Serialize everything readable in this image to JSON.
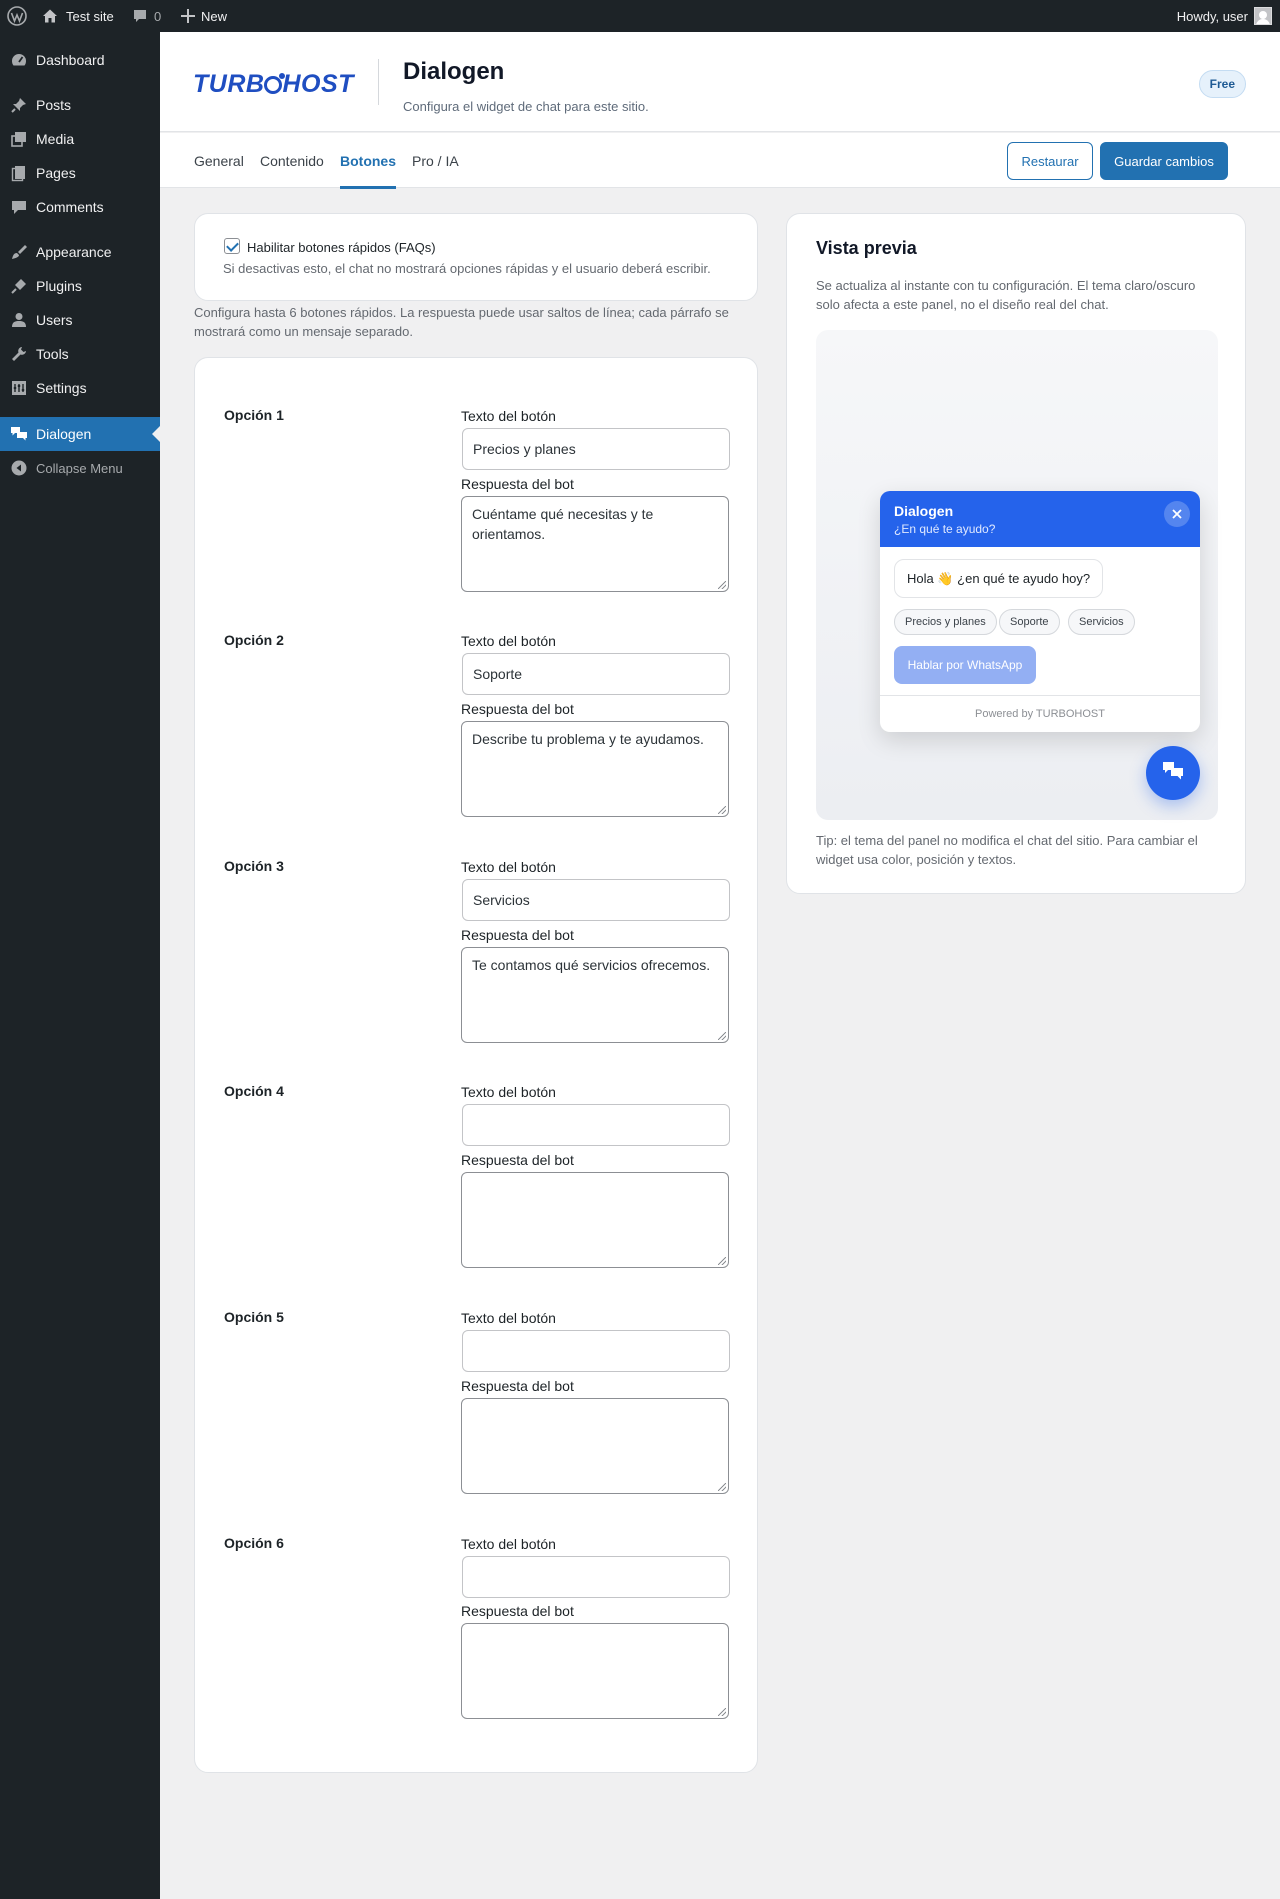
{
  "adminbar": {
    "site_name": "Test site",
    "comments_count": "0",
    "new_label": "New",
    "greeting": "Howdy, user"
  },
  "sidebar": {
    "items": [
      {
        "label": "Dashboard",
        "icon": "dashboard-icon"
      },
      {
        "label": "Posts",
        "icon": "pin-icon"
      },
      {
        "label": "Media",
        "icon": "media-icon"
      },
      {
        "label": "Pages",
        "icon": "pages-icon"
      },
      {
        "label": "Comments",
        "icon": "comment-icon"
      },
      {
        "label": "Appearance",
        "icon": "brush-icon"
      },
      {
        "label": "Plugins",
        "icon": "plug-icon"
      },
      {
        "label": "Users",
        "icon": "user-icon"
      },
      {
        "label": "Tools",
        "icon": "wrench-icon"
      },
      {
        "label": "Settings",
        "icon": "settings-icon"
      },
      {
        "label": "Dialogen",
        "icon": "chat-bubbles-icon",
        "active": true
      }
    ],
    "collapse_label": "Collapse Menu"
  },
  "header": {
    "logo_text_before": "TURB",
    "logo_text_after": "HOST",
    "title": "Dialogen",
    "subtitle": "Configura el widget de chat para este sitio.",
    "plan_badge": "Free"
  },
  "tabs": [
    {
      "label": "General"
    },
    {
      "label": "Contenido"
    },
    {
      "label": "Botones",
      "active": true
    },
    {
      "label": "Pro / IA"
    }
  ],
  "actions": {
    "restore_label": "Restaurar",
    "save_label": "Guardar cambios"
  },
  "faq_toggle": {
    "checked": true,
    "label": "Habilitar botones rápidos (FAQs)",
    "help": "Si desactivas esto, el chat no mostrará opciones rápidas y el usuario deberá escribir."
  },
  "intro_note": "Configura hasta 6 botones rápidos. La respuesta puede usar saltos de línea; cada párrafo se mostrará como un mensaje separado.",
  "options": [
    {
      "title": "Opción 1",
      "button_label": "Texto del botón",
      "button_value": "Precios y planes",
      "response_label": "Respuesta del bot",
      "response_value": "Cuéntame qué necesitas y te orientamos."
    },
    {
      "title": "Opción 2",
      "button_label": "Texto del botón",
      "button_value": "Soporte",
      "response_label": "Respuesta del bot",
      "response_value": "Describe tu problema y te ayudamos."
    },
    {
      "title": "Opción 3",
      "button_label": "Texto del botón",
      "button_value": "Servicios",
      "response_label": "Respuesta del bot",
      "response_value": "Te contamos qué servicios ofrecemos."
    },
    {
      "title": "Opción 4",
      "button_label": "Texto del botón",
      "button_value": "",
      "response_label": "Respuesta del bot",
      "response_value": ""
    },
    {
      "title": "Opción 5",
      "button_label": "Texto del botón",
      "button_value": "",
      "response_label": "Respuesta del bot",
      "response_value": ""
    },
    {
      "title": "Opción 6",
      "button_label": "Texto del botón",
      "button_value": "",
      "response_label": "Respuesta del bot",
      "response_value": ""
    }
  ],
  "preview": {
    "title": "Vista previa",
    "description": "Se actualiza al instante con tu configuración. El tema claro/oscuro solo afecta a este panel, no el diseño real del chat.",
    "chat": {
      "header_title": "Dialogen",
      "header_subtitle": "¿En qué te ayudo?",
      "greeting": "Hola 👋 ¿en qué te ayudo hoy?",
      "chips": [
        "Precios y planes",
        "Soporte",
        "Servicios"
      ],
      "whatsapp_label": "Hablar por WhatsApp",
      "footer": "Powered by TURBOHOST"
    },
    "tip": "Tip: el tema del panel no modifica el chat del sitio. Para cambiar el widget usa color, posición y textos."
  },
  "colors": {
    "wp_dark": "#1d2327",
    "wp_blue": "#2271b1",
    "chat_blue": "#2563eb",
    "whatsapp_button": "#93aff3"
  }
}
